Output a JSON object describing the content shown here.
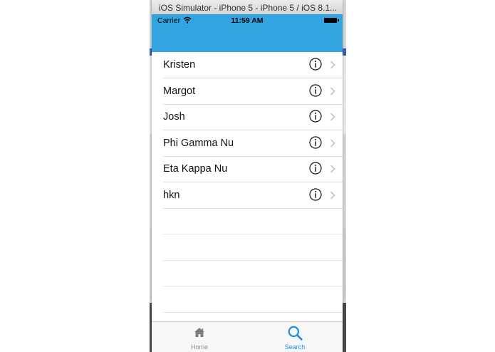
{
  "window": {
    "title": "iOS Simulator - iPhone 5 - iPhone 5 / iOS 8.1..."
  },
  "status_bar": {
    "carrier": "Carrier",
    "time": "11:59 AM"
  },
  "colors": {
    "nav_bar": "#34a4e0",
    "tab_active": "#1a8fe0",
    "tab_inactive": "#8e8e93"
  },
  "list": {
    "rows": [
      {
        "label": "Kristen"
      },
      {
        "label": "Margot"
      },
      {
        "label": "Josh"
      },
      {
        "label": "Phi Gamma Nu"
      },
      {
        "label": "Eta Kappa Nu"
      },
      {
        "label": "hkn"
      }
    ]
  },
  "tab_bar": {
    "home_label": "Home",
    "search_label": "Search",
    "selected": "Search"
  }
}
